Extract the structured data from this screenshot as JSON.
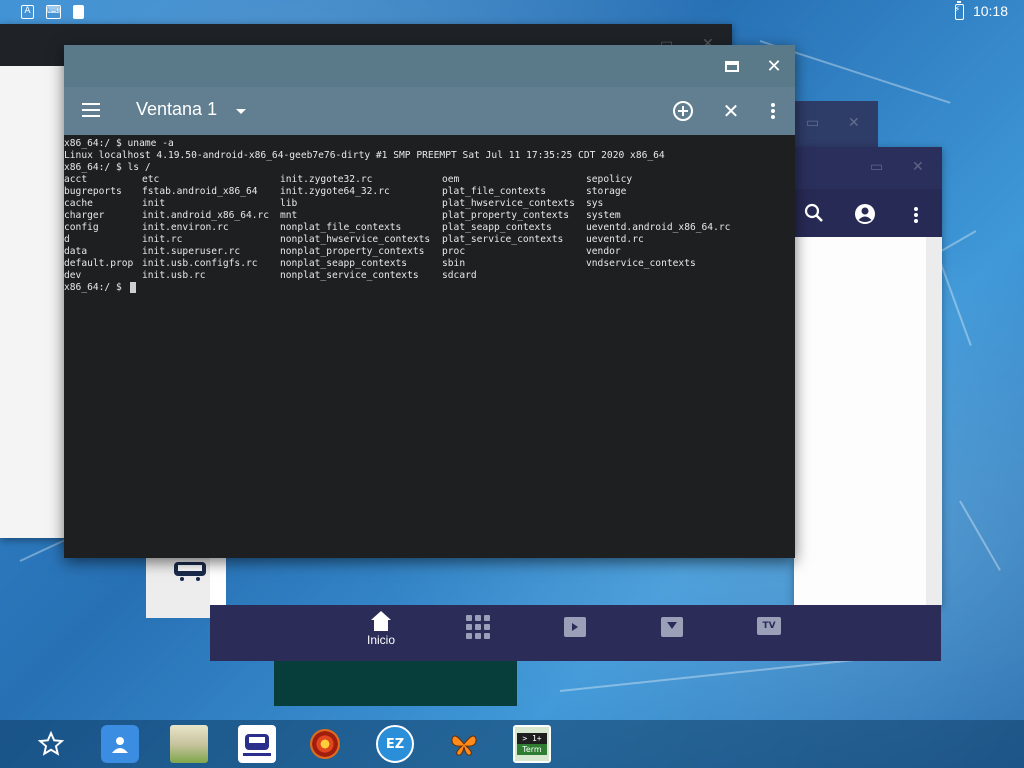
{
  "status_bar": {
    "time": "10:18",
    "icons": [
      "a-icon",
      "keyboard-icon",
      "sd-card-icon"
    ],
    "icon_text": {
      "a": "A",
      "kb": "⌨"
    }
  },
  "terminal": {
    "window_name": "Ventana 1",
    "lines": [
      "x86_64:/ $ uname -a",
      "Linux localhost 4.19.50-android-x86_64-geeb7e76-dirty #1 SMP PREEMPT Sat Jul 11 17:35:25 CDT 2020 x86_64",
      "x86_64:/ $ ls /"
    ],
    "ls_rows": [
      [
        "acct",
        "etc",
        "init.zygote32.rc",
        "oem",
        "sepolicy"
      ],
      [
        "bugreports",
        "fstab.android_x86_64",
        "init.zygote64_32.rc",
        "plat_file_contexts",
        "storage"
      ],
      [
        "cache",
        "init",
        "lib",
        "plat_hwservice_contexts",
        "sys"
      ],
      [
        "charger",
        "init.android_x86_64.rc",
        "mnt",
        "plat_property_contexts",
        "system"
      ],
      [
        "config",
        "init.environ.rc",
        "nonplat_file_contexts",
        "plat_seapp_contexts",
        "ueventd.android_x86_64.rc"
      ],
      [
        "d",
        "init.rc",
        "nonplat_hwservice_contexts",
        "plat_service_contexts",
        "ueventd.rc"
      ],
      [
        "data",
        "init.superuser.rc",
        "nonplat_property_contexts",
        "proc",
        "vendor"
      ],
      [
        "default.prop",
        "init.usb.configfs.rc",
        "nonplat_seapp_contexts",
        "sbin",
        "vndservice_contexts"
      ],
      [
        "dev",
        "init.usb.rc",
        "nonplat_service_contexts",
        "sdcard",
        ""
      ]
    ],
    "prompt": "x86_64:/ $ "
  },
  "app_nav": {
    "items": [
      {
        "label": "Inicio",
        "icon": "home-icon"
      },
      {
        "label": "",
        "icon": "apps-grid-icon"
      },
      {
        "label": "",
        "icon": "video-icon"
      },
      {
        "label": "",
        "icon": "download-icon"
      },
      {
        "label": "",
        "icon": "tv-icon"
      }
    ],
    "tv_text": "TV"
  },
  "dock": {
    "apps": [
      "star-icon",
      "contacts-icon",
      "gallery-icon",
      "train-icon",
      "spiral-icon",
      "ez-icon",
      "butterfly-icon",
      "terminal-app-icon"
    ],
    "ez_text": "EZ",
    "term_line1": "> 1+",
    "term_line2": "Term"
  }
}
